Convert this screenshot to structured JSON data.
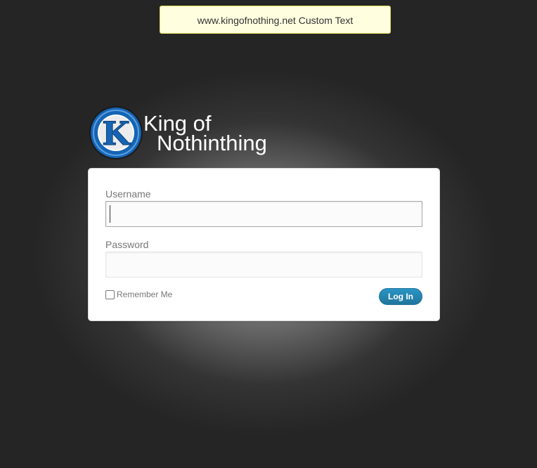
{
  "notice": {
    "text": "www.kingofnothing.net Custom Text"
  },
  "logo": {
    "emblem_letter": "K",
    "line1": "King of",
    "line2": "Nothinthing"
  },
  "login": {
    "username_label": "Username",
    "username_value": "",
    "password_label": "Password",
    "password_value": "",
    "remember_label": "Remember Me",
    "remember_checked": false,
    "submit_label": "Log In"
  },
  "colors": {
    "background": "#252525",
    "notice_background": "#ffffe0",
    "notice_border": "#e6db55",
    "button_blue": "#21759b",
    "emblem_blue": "#1565b4"
  }
}
